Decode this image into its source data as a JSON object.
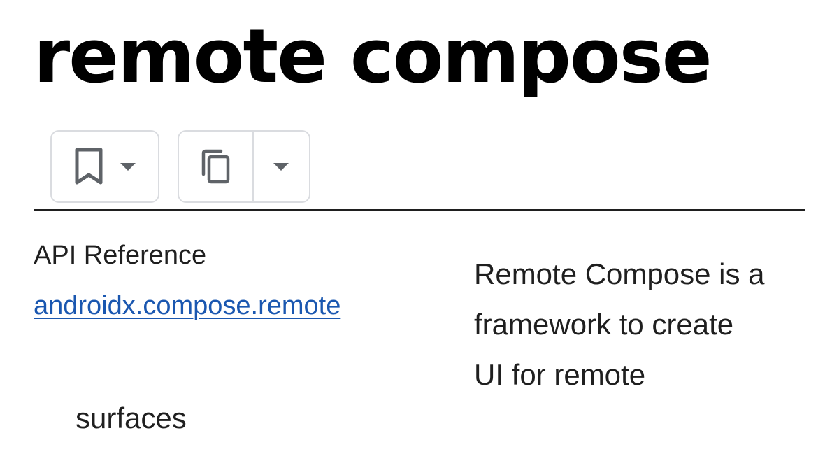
{
  "page": {
    "title": "remote compose"
  },
  "toolbar": {
    "bookmark": {
      "icon": "bookmark-icon",
      "menu_icon": "caret-down-icon"
    },
    "copy": {
      "icon": "copy-icon",
      "menu_icon": "caret-down-icon"
    }
  },
  "api": {
    "label": "API Reference",
    "link_text": "androidx.compose.remote"
  },
  "description": {
    "text": "Remote Compose is a\nframework to create\nUI for remote"
  },
  "overflow_text": "surfaces",
  "colors": {
    "link": "#1a57b0",
    "border": "#dadce0",
    "icon": "#5f6368"
  }
}
